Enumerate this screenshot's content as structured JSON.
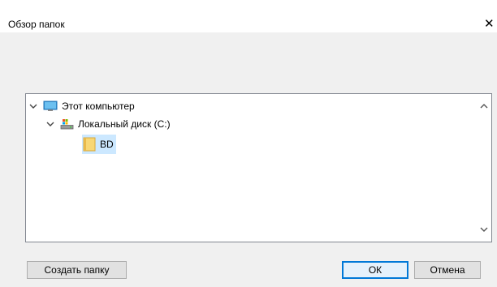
{
  "window": {
    "title": "Обзор папок",
    "close_glyph": "✕"
  },
  "tree": {
    "items": [
      {
        "label": "Этот компьютер",
        "icon": "computer-icon",
        "expanded": true
      },
      {
        "label": "Локальный диск (C:)",
        "icon": "drive-icon",
        "expanded": true
      },
      {
        "label": "BD",
        "icon": "folder-icon",
        "selected": true
      }
    ]
  },
  "buttons": {
    "create_folder": "Создать папку",
    "ok": "ОК",
    "cancel": "Отмена"
  },
  "colors": {
    "selection": "#cce8ff",
    "accent": "#0078d7",
    "folder": "#f8d775"
  }
}
